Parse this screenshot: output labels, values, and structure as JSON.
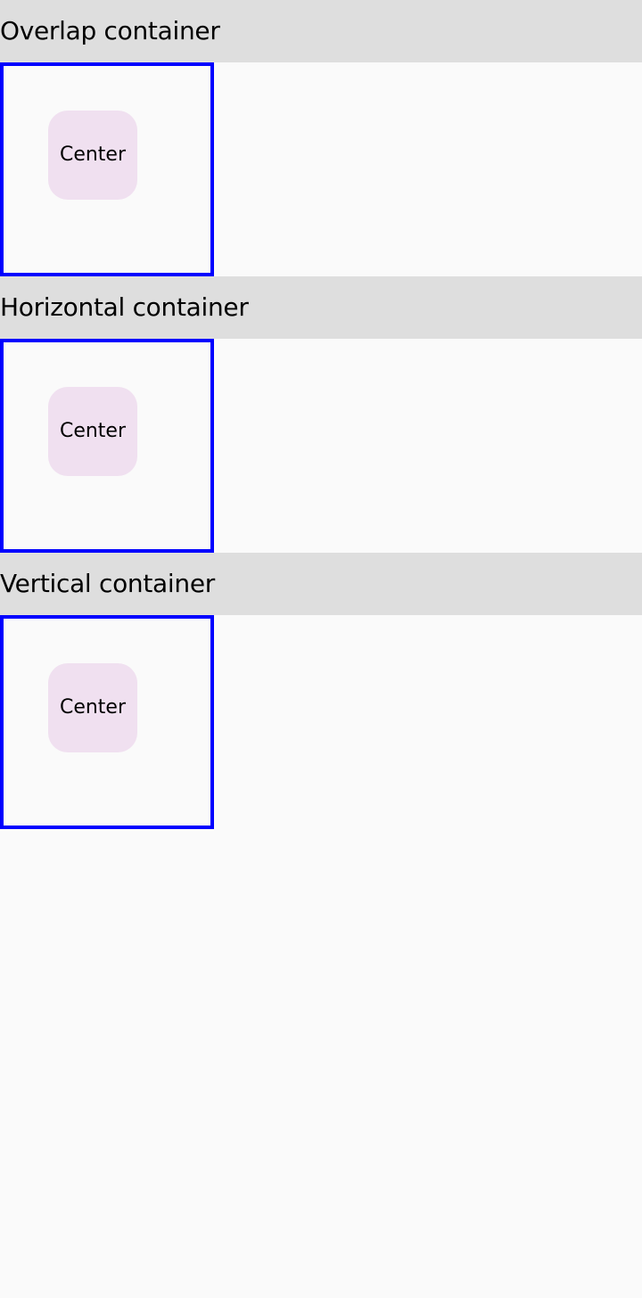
{
  "colors": {
    "page_background": "#fafafa",
    "header_background": "#dedede",
    "frame_border": "#0000ff",
    "chip_background": "#f0e0f0",
    "text": "#000000"
  },
  "sections": [
    {
      "title": "Overlap container",
      "item_label": "Center"
    },
    {
      "title": "Horizontal container",
      "item_label": "Center"
    },
    {
      "title": "Vertical container",
      "item_label": "Center"
    }
  ]
}
